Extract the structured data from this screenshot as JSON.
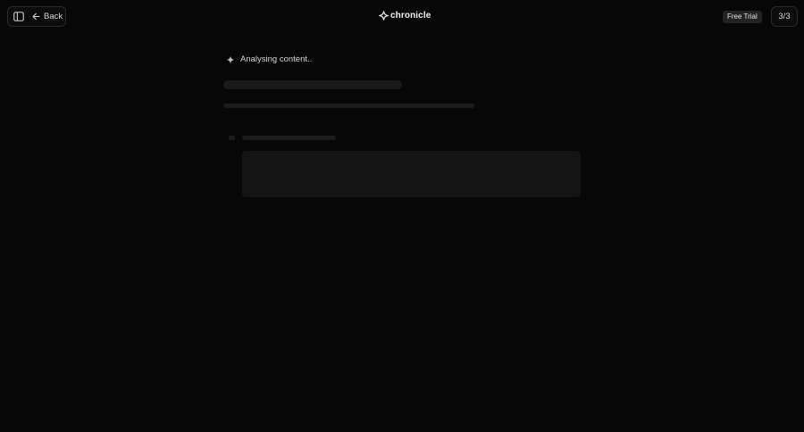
{
  "header": {
    "back_label": "Back",
    "brand_name": "chronicle",
    "trial_badge": "Free Trial",
    "counter": "3/3"
  },
  "icons": {
    "sidebar_toggle": "sidebar-panel-icon",
    "back": "arrow-left-icon",
    "logo": "sparkle-logo-icon",
    "status": "sparkle-icon"
  },
  "status": {
    "text": "Analysing content.."
  },
  "colors": {
    "background": "#070707",
    "skeleton": "#1a1a1a",
    "text": "#e6e6e6"
  }
}
